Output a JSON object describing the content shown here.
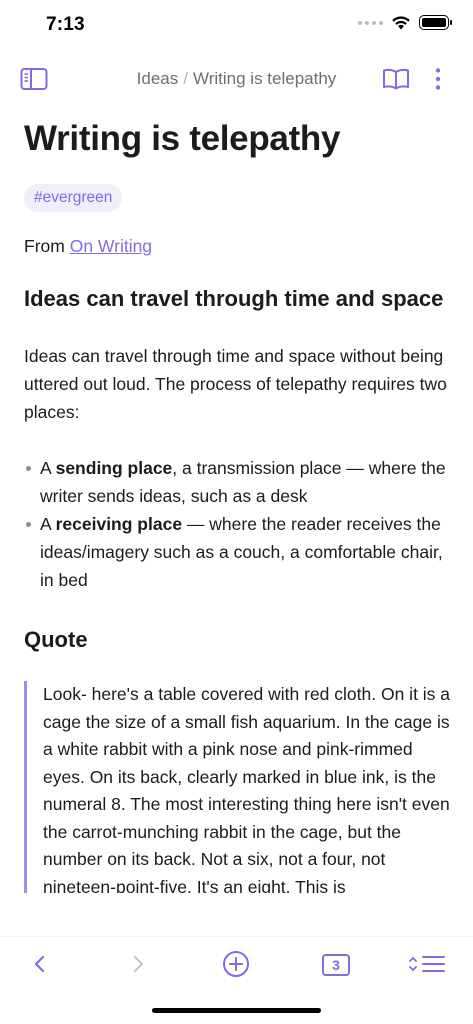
{
  "status_bar": {
    "time": "7:13",
    "icons": [
      "signal-dots-icon",
      "wifi-icon",
      "battery-icon"
    ]
  },
  "nav": {
    "breadcrumb_parent": "Ideas",
    "breadcrumb_separator": "/",
    "breadcrumb_current": "Writing is telepathy",
    "left_icon": "sidebar-icon",
    "right_icons": [
      "book-icon",
      "more-vertical-icon"
    ]
  },
  "note": {
    "title": "Writing is telepathy",
    "tag": "#evergreen",
    "from_label": "From",
    "from_link": "On Writing",
    "heading_1": "Ideas can travel through time and space",
    "paragraph_1": "Ideas can travel through time and space without being uttered out loud. The process of telepathy requires two places:",
    "bullets": [
      {
        "prefix": "A",
        "bold": "sending place",
        "rest": ", a transmission place — where the writer sends ideas, such as a desk"
      },
      {
        "prefix": "A",
        "bold": "receiving place",
        "rest": " — where the reader receives the ideas/imagery such as a couch, a comfortable chair, in bed"
      }
    ],
    "heading_2": "Quote",
    "quote": "Look- here's a table covered with red cloth. On it is a cage the size of a small fish aquarium. In the cage is a white rabbit with a pink nose and pink-rimmed eyes. On its back, clearly marked in blue ink, is the numeral 8. The most interesting thing here isn't even the carrot-munching rabbit in the cage, but the number on its back. Not a six, not a four, not nineteen-point-five. It's an eight. This is"
  },
  "toolbar": {
    "back_icon": "chevron-left-icon",
    "forward_icon": "chevron-right-icon",
    "add_icon": "plus-circle-icon",
    "count": "3",
    "outline_icon": "outline-icon"
  },
  "colors": {
    "accent": "#7b6ee6",
    "tag_background": "#f0eefb",
    "text": "#1c1c1e",
    "muted": "#6e6e73",
    "quote_bar": "#9b8ff0"
  }
}
